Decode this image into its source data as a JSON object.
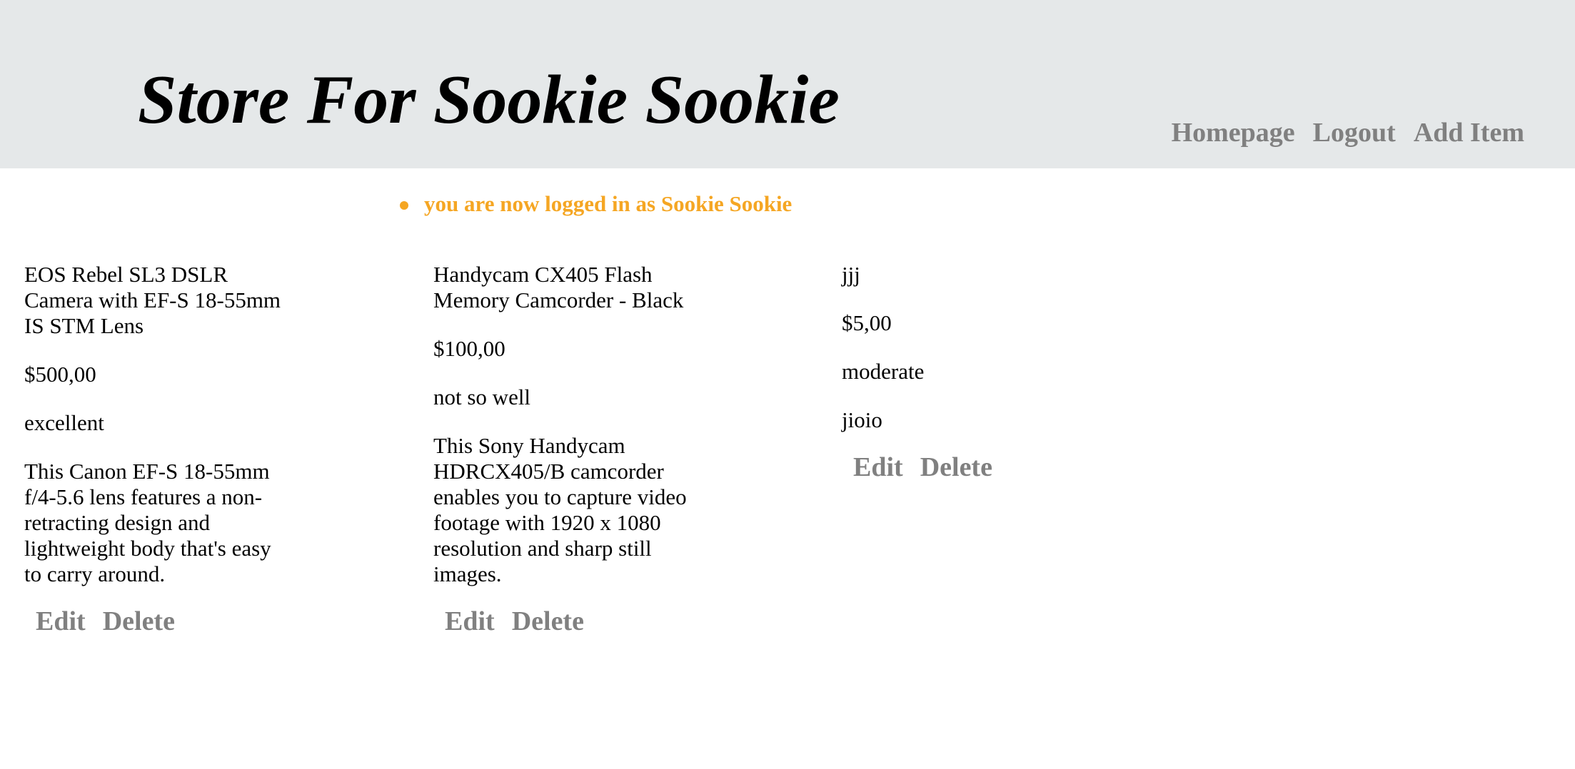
{
  "header": {
    "title": "Store For Sookie Sookie",
    "nav": [
      {
        "label": "Homepage"
      },
      {
        "label": "Logout"
      },
      {
        "label": "Add Item"
      }
    ]
  },
  "flash": {
    "messages": [
      "you are now logged in as Sookie Sookie"
    ]
  },
  "items": [
    {
      "name": "EOS Rebel SL3 DSLR Camera with EF-S 18-55mm IS STM Lens",
      "price": "$500,00",
      "condition": "excellent",
      "description": "This Canon EF-S 18-55mm f/4-5.6 lens features a non-retracting design and lightweight body that's easy to carry around.",
      "edit_label": "Edit",
      "delete_label": "Delete"
    },
    {
      "name": "Handycam CX405 Flash Memory Camcorder - Black",
      "price": "$100,00",
      "condition": "not so well",
      "description": "This Sony Handycam HDRCX405/B camcorder enables you to capture video footage with 1920 x 1080 resolution and sharp still images.",
      "edit_label": "Edit",
      "delete_label": "Delete"
    },
    {
      "name": "jjj",
      "price": "$5,00",
      "condition": "moderate",
      "description": "jioio",
      "edit_label": "Edit",
      "delete_label": "Delete"
    }
  ],
  "colors": {
    "header_bg": "#e5e8e9",
    "link": "#808080",
    "flash": "#f5a623"
  }
}
